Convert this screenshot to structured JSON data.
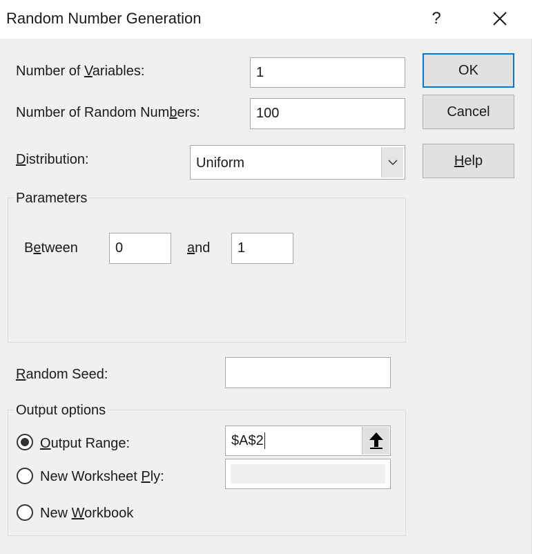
{
  "window": {
    "title": "Random Number Generation",
    "help_glyph": "?",
    "close_icon": "close-icon"
  },
  "fields": {
    "num_variables": {
      "label": [
        "Number of ",
        "V",
        "ariables:"
      ],
      "value": "1"
    },
    "num_random": {
      "label": [
        "Number of Random Num",
        "b",
        "ers:"
      ],
      "value": "100"
    },
    "distribution": {
      "label": [
        "",
        "D",
        "istribution:"
      ],
      "value": "Uniform"
    }
  },
  "parameters": {
    "group_label": "Parameters",
    "between_label": [
      "B",
      "e",
      "tween"
    ],
    "between_value": "0",
    "and_label": [
      "",
      "a",
      "nd"
    ],
    "and_value": "1"
  },
  "seed": {
    "label": [
      "",
      "R",
      "andom Seed:"
    ],
    "value": ""
  },
  "output": {
    "group_label": "Output options",
    "range": {
      "label": [
        "",
        "O",
        "utput Range:"
      ],
      "value": "$A$2",
      "selected": true
    },
    "worksheet": {
      "label": [
        "New Worksheet ",
        "P",
        "ly:"
      ],
      "selected": false
    },
    "workbook": {
      "label": [
        "New ",
        "W",
        "orkbook"
      ],
      "selected": false
    }
  },
  "buttons": {
    "ok": "OK",
    "cancel": "Cancel",
    "help": [
      "",
      "H",
      "elp"
    ]
  }
}
